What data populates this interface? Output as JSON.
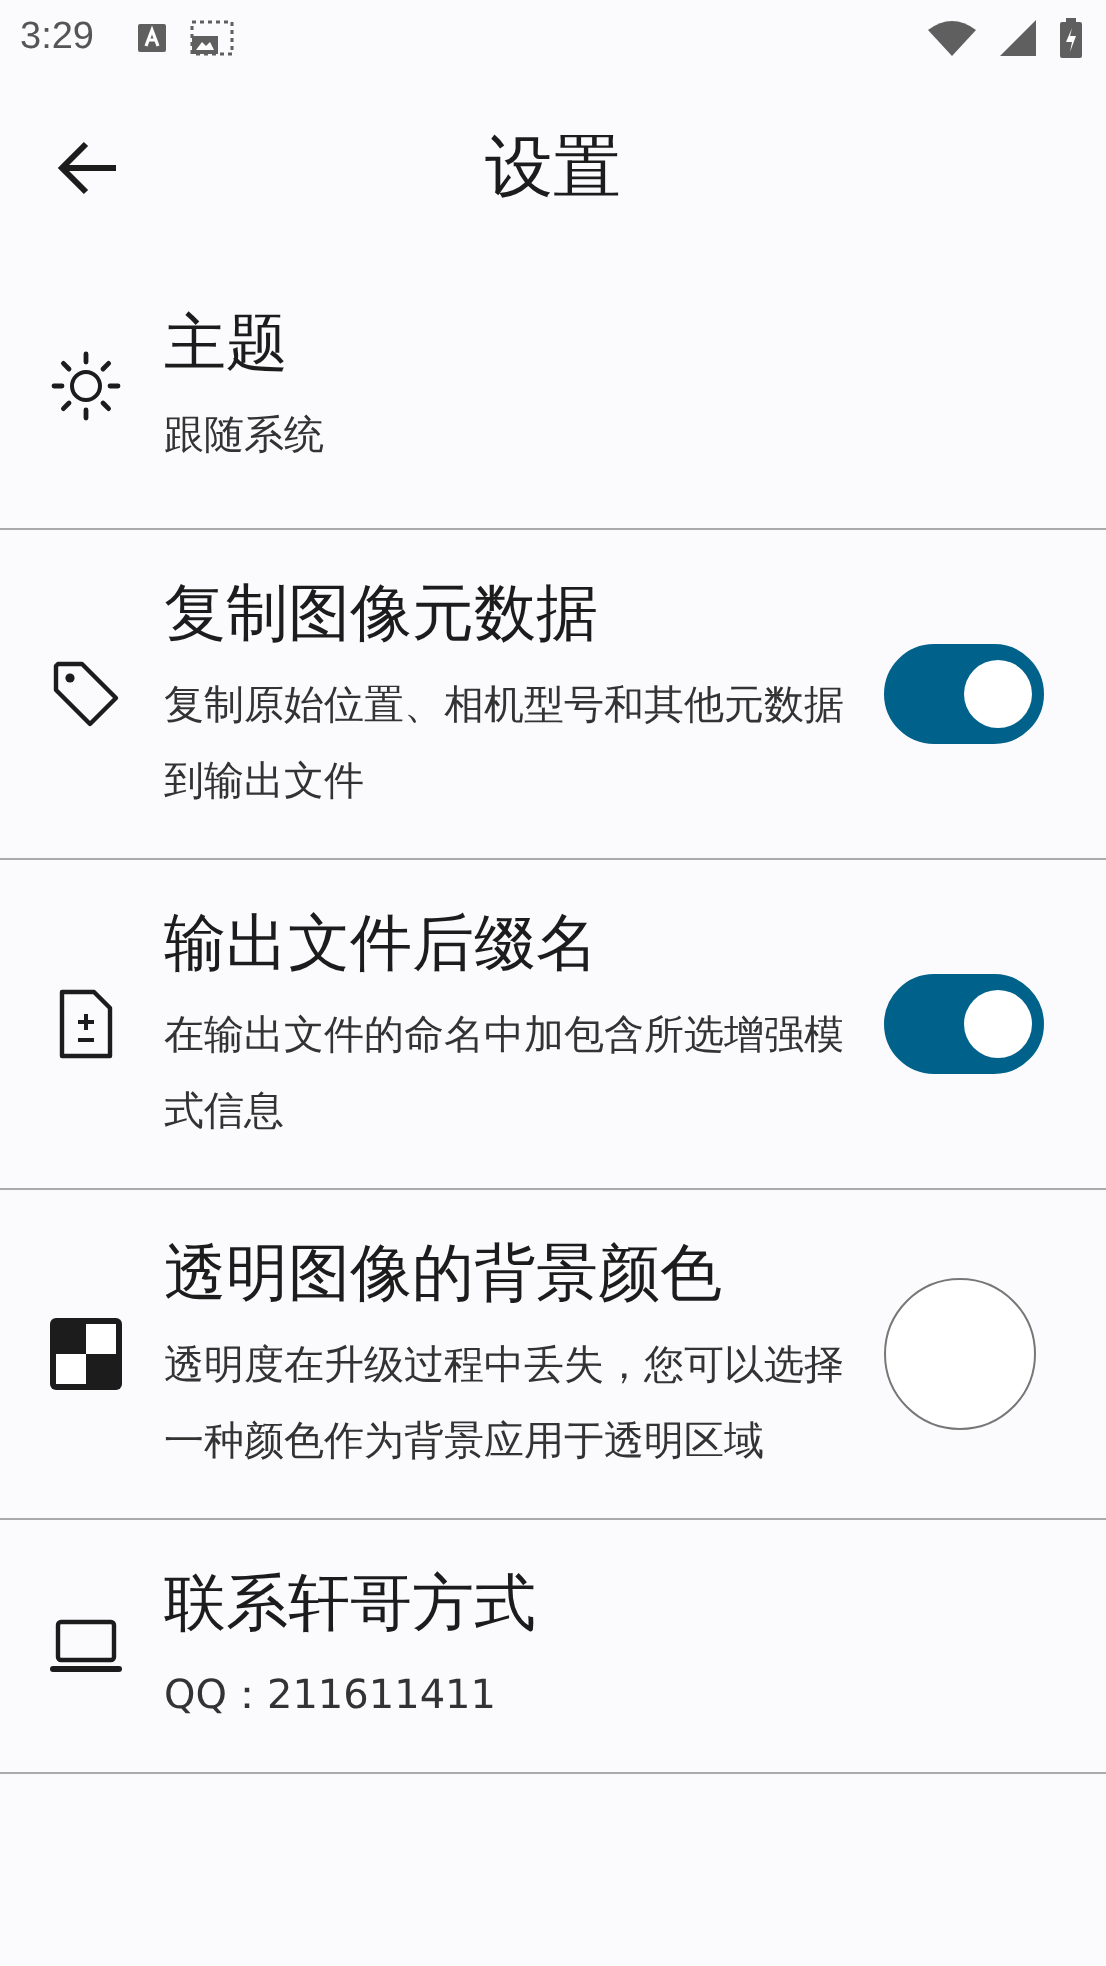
{
  "status_bar": {
    "time": "3:29"
  },
  "app_bar": {
    "title": "设置"
  },
  "settings": [
    {
      "kind": "plain",
      "title": "主题",
      "subtitle": "跟随系统"
    },
    {
      "kind": "toggle",
      "title": "复制图像元数据",
      "subtitle": "复制原始位置、相机型号和其他元数据到输出文件",
      "on": true
    },
    {
      "kind": "toggle",
      "title": "输出文件后缀名",
      "subtitle": "在输出文件的命名中加包含所选增强模式信息",
      "on": true
    },
    {
      "kind": "color",
      "title": "透明图像的背景颜色",
      "subtitle": "透明度在升级过程中丢失，您可以选择一种颜色作为背景应用于透明区域",
      "color": "#ffffff"
    },
    {
      "kind": "plain",
      "title": "联系轩哥方式",
      "subtitle": "QQ：211611411"
    }
  ]
}
